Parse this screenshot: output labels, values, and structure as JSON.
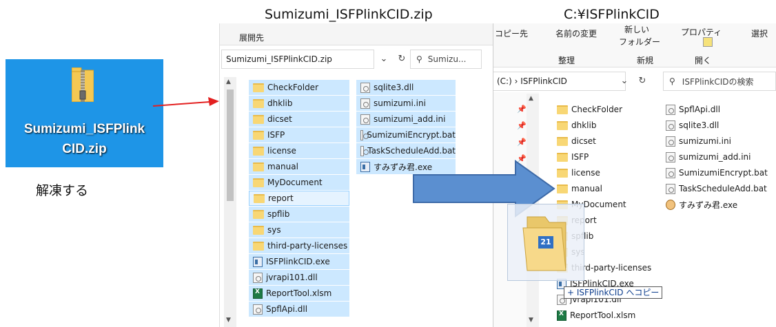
{
  "captions": {
    "zip_title": "Sumizumi_ISFPlinkCID.zip",
    "dest_title": "C:¥ISFPlinkCID",
    "extract_label": "解凍する"
  },
  "desktop_icon": {
    "line1": "Sumizumi_ISFPlink",
    "line2": "CID.zip"
  },
  "zip_window": {
    "ribbon_tab": "展開先",
    "address": "Sumizumi_ISFPlinkCID.zip",
    "search_placeholder": "Sumizu...",
    "col1": [
      {
        "name": "CheckFolder",
        "icon": "folder-icon"
      },
      {
        "name": "dhklib",
        "icon": "folder-icon"
      },
      {
        "name": "dicset",
        "icon": "folder-icon"
      },
      {
        "name": "ISFP",
        "icon": "folder-icon"
      },
      {
        "name": "license",
        "icon": "folder-icon"
      },
      {
        "name": "manual",
        "icon": "folder-icon"
      },
      {
        "name": "MyDocument",
        "icon": "folder-icon"
      },
      {
        "name": "report",
        "icon": "folder-icon"
      },
      {
        "name": "spflib",
        "icon": "folder-icon"
      },
      {
        "name": "sys",
        "icon": "folder-icon"
      },
      {
        "name": "third-party-licenses",
        "icon": "folder-icon"
      },
      {
        "name": "ISFPlinkCID.exe",
        "icon": "exe-icon"
      },
      {
        "name": "jvrapi101.dll",
        "icon": "dll-icon"
      },
      {
        "name": "ReportTool.xlsm",
        "icon": "excel-icon"
      },
      {
        "name": "SpflApi.dll",
        "icon": "dll-icon"
      }
    ],
    "col2": [
      {
        "name": "sqlite3.dll",
        "icon": "dll-icon"
      },
      {
        "name": "sumizumi.ini",
        "icon": "ini-icon"
      },
      {
        "name": "sumizumi_add.ini",
        "icon": "ini-icon"
      },
      {
        "name": "SumizumiEncrypt.bat",
        "icon": "bat-icon"
      },
      {
        "name": "TaskScheduleAdd.bat",
        "icon": "bat-icon"
      },
      {
        "name": "すみずみ君.exe",
        "icon": "exe-icon"
      }
    ]
  },
  "dest_window": {
    "ribbon": {
      "copy_to": "コピー先",
      "rename": "名前の変更",
      "new_line1": "新しい",
      "new_line2": "フォルダー",
      "properties": "プロパティ",
      "select": "選択",
      "group_organize": "整理",
      "group_new": "新規",
      "group_open": "開く"
    },
    "address": "(C:)  ›  ISFPlinkCID",
    "search_placeholder": "ISFPlinkCIDの検索",
    "col1": [
      {
        "name": "CheckFolder",
        "icon": "folder-icon"
      },
      {
        "name": "dhklib",
        "icon": "folder-icon"
      },
      {
        "name": "dicset",
        "icon": "folder-icon"
      },
      {
        "name": "ISFP",
        "icon": "folder-icon"
      },
      {
        "name": "license",
        "icon": "folder-icon"
      },
      {
        "name": "manual",
        "icon": "folder-icon"
      },
      {
        "name": "MyDocument",
        "icon": "folder-icon"
      },
      {
        "name": "report",
        "icon": "folder-icon"
      },
      {
        "name": "spflib",
        "icon": "folder-icon"
      },
      {
        "name": "sys",
        "icon": "folder-icon"
      },
      {
        "name": "third-party-licenses",
        "icon": "folder-icon"
      },
      {
        "name": "ISFPlinkCID.exe",
        "icon": "exe-icon"
      },
      {
        "name": "jvrapi101.dll",
        "icon": "dll-icon"
      },
      {
        "name": "ReportTool.xlsm",
        "icon": "excel-icon"
      }
    ],
    "col2": [
      {
        "name": "SpflApi.dll",
        "icon": "dll-icon"
      },
      {
        "name": "sqlite3.dll",
        "icon": "dll-icon"
      },
      {
        "name": "sumizumi.ini",
        "icon": "ini-icon"
      },
      {
        "name": "sumizumi_add.ini",
        "icon": "ini-icon"
      },
      {
        "name": "SumizumiEncrypt.bat",
        "icon": "bat-icon"
      },
      {
        "name": "TaskScheduleAdd.bat",
        "icon": "bat-icon"
      },
      {
        "name": "すみずみ君.exe",
        "icon": "app-icon"
      }
    ]
  },
  "drag": {
    "count": "21",
    "tooltip": "+ ISFPlinkCID へコピー"
  },
  "colors": {
    "desktop_blue": "#1e95e7",
    "selection": "#cce8ff",
    "arrow_fill": "#5b8fd0",
    "red_arrow": "#e32020"
  }
}
